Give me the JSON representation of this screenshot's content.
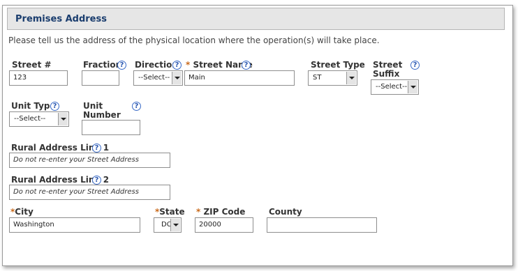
{
  "section_title": "Premises Address",
  "intro": "Please tell us the address of the physical location where the operation(s) will take place.",
  "required_marker": "*",
  "help_glyph": "?",
  "fields": {
    "street_number": {
      "label": "Street #",
      "value": "123"
    },
    "fraction": {
      "label": "Fraction",
      "value": ""
    },
    "direction": {
      "label": "Direction",
      "selected": "--Select--"
    },
    "street_name": {
      "label": "Street Name",
      "value": "Main"
    },
    "street_type": {
      "label": "Street Type",
      "selected": "ST"
    },
    "street_suffix": {
      "label_line1": "Street",
      "label_line2": "Suffix",
      "selected": "--Select--"
    },
    "unit_type": {
      "label": "Unit Type",
      "selected": "--Select--"
    },
    "unit_number": {
      "label_line1": "Unit",
      "label_line2": "Number",
      "value": ""
    },
    "rural_line1": {
      "label": "Rural Address Line 1",
      "placeholder": "Do not re-enter your Street Address"
    },
    "rural_line2": {
      "label": "Rural Address Line 2",
      "placeholder": "Do not re-enter your Street Address"
    },
    "city": {
      "label": "City",
      "value": "Washington"
    },
    "state": {
      "label": "State",
      "selected": "DC"
    },
    "zip": {
      "label": "ZIP Code",
      "value": "20000"
    },
    "county": {
      "label": "County",
      "value": ""
    }
  },
  "colors": {
    "header_bg": "#e6e6e6",
    "title": "#1a3d6e",
    "required": "#c96a1b",
    "help": "#2a57b0"
  }
}
